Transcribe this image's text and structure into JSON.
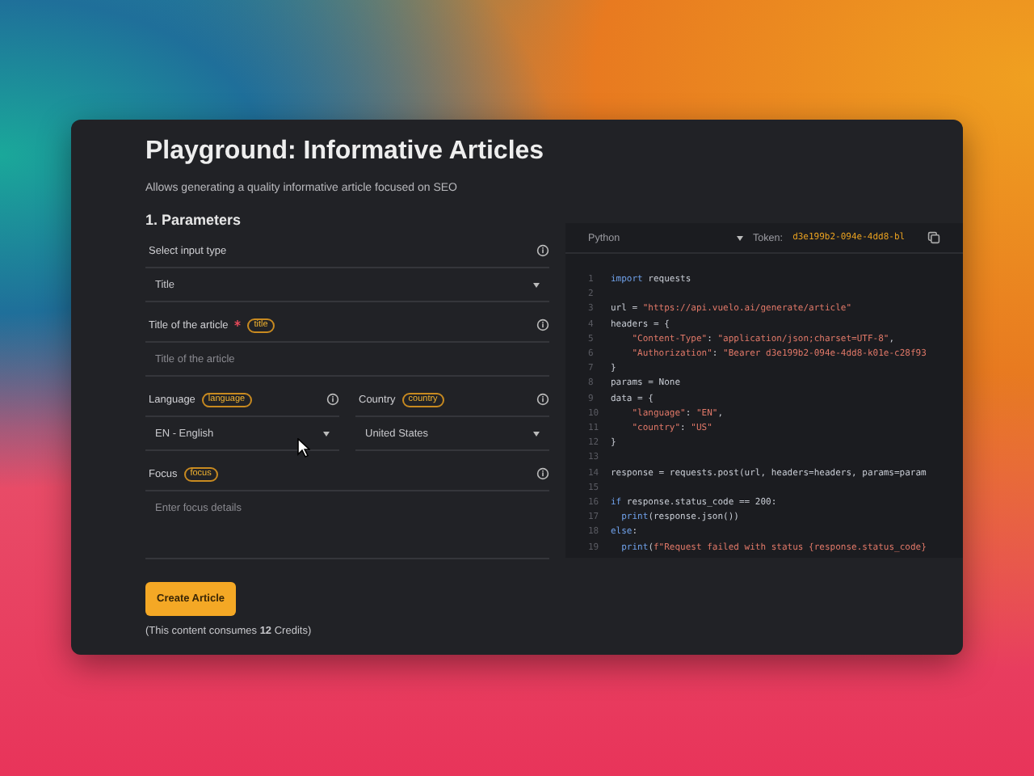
{
  "title": "Playground: Informative Articles",
  "subtitle": "Allows generating a quality informative article focused on SEO",
  "section": "1. Parameters",
  "fields": [
    {
      "kind": "select",
      "label": "Select input type",
      "required": false,
      "value": "Title"
    },
    {
      "kind": "text",
      "label": "Title of the article",
      "required": true,
      "tag": "title",
      "placeholder": "Title of the article"
    },
    {
      "kind": "pair",
      "items": [
        {
          "label": "Language",
          "tag": "language",
          "value": "EN - English"
        },
        {
          "label": "Country",
          "tag": "country",
          "value": "United States"
        }
      ]
    },
    {
      "kind": "textarea",
      "label": "Focus",
      "required": false,
      "tag": "focus",
      "placeholder": "Enter focus details"
    }
  ],
  "button": "Create Article",
  "credits": "(This content consumes **12** Credits)",
  "code": {
    "language": "Python",
    "token_label": "Token:",
    "token": "d3e199b2-094e-4dd8-bl",
    "lines": [
      {
        "n": "1",
        "segments": [
          {
            "keyword": "import"
          },
          {
            "plain": " requests"
          }
        ]
      },
      {
        "n": "2"
      },
      {
        "n": "3",
        "segments": [
          {
            "plain": "url = "
          },
          {
            "string": "\"https://api.vuelo.ai/generate/article\""
          }
        ]
      },
      {
        "n": "4",
        "segments": [
          {
            "plain": "headers = {"
          }
        ]
      },
      {
        "n": "5",
        "segments": [
          {
            "string": "    \"Content-Type\""
          },
          {
            "plain": ": "
          },
          {
            "string": "\"application/json;charset=UTF-8\""
          },
          {
            "plain": ","
          }
        ]
      },
      {
        "n": "6",
        "segments": [
          {
            "string": "    \"Authorization\""
          },
          {
            "plain": ": "
          },
          {
            "string": "\"Bearer d3e199b2-094e-4dd8-k01e-c28f93"
          }
        ]
      },
      {
        "n": "7",
        "segments": [
          {
            "plain": "}"
          }
        ]
      },
      {
        "n": "8",
        "segments": [
          {
            "plain": "params = None"
          }
        ]
      },
      {
        "n": "9",
        "segments": [
          {
            "plain": "data = {"
          }
        ]
      },
      {
        "n": "10",
        "segments": [
          {
            "string": "    \"language\""
          },
          {
            "plain": ": "
          },
          {
            "string": "\"EN\""
          },
          {
            "plain": ","
          }
        ]
      },
      {
        "n": "11",
        "segments": [
          {
            "string": "    \"country\""
          },
          {
            "plain": ": "
          },
          {
            "string": "\"US\""
          }
        ]
      },
      {
        "n": "12",
        "segments": [
          {
            "plain": "}"
          }
        ]
      },
      {
        "n": "13"
      },
      {
        "n": "14",
        "segments": [
          {
            "plain": "response = requests.post(url, headers=headers, params=param"
          }
        ]
      },
      {
        "n": "15"
      },
      {
        "n": "16",
        "segments": [
          {
            "keyword": "if"
          },
          {
            "plain": " response.status_code == 200:"
          }
        ]
      },
      {
        "n": "17",
        "segments": [
          {
            "keyword": "  print"
          },
          {
            "plain": "(response.json())"
          }
        ]
      },
      {
        "n": "18",
        "segments": [
          {
            "keyword": "else"
          },
          {
            "plain": ":"
          }
        ]
      },
      {
        "n": "19",
        "segments": [
          {
            "keyword": "  print"
          },
          {
            "plain": "("
          },
          {
            "string": "f\"Request failed with status {response.status_code}"
          }
        ]
      }
    ]
  }
}
